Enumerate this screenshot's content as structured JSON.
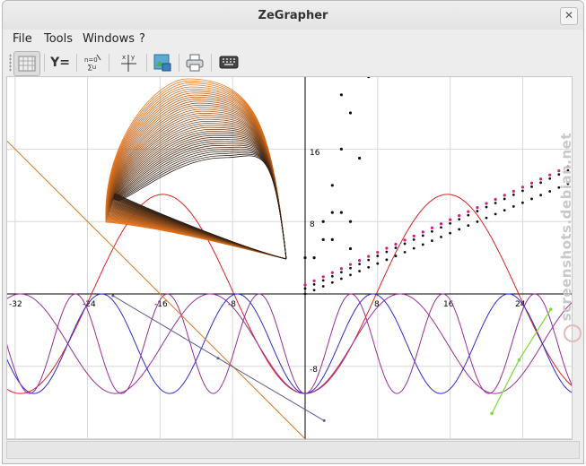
{
  "window": {
    "title": "ZeGrapher"
  },
  "menu": {
    "items": [
      "File",
      "Tools",
      "Windows",
      "?"
    ]
  },
  "toolbar": {
    "grid_button": "grid-toggle",
    "functions_label": "Y=",
    "sequences_label": "x y",
    "params_label": "x | y"
  },
  "graph": {
    "x_ticks": [
      "-32",
      "-24",
      "-16",
      "-8",
      "8",
      "16",
      "24"
    ],
    "y_ticks": [
      "16",
      "8",
      "-8"
    ],
    "colors": {
      "orange": "#e8761e",
      "red": "#e22020",
      "blue": "#2b2bd8",
      "purple": "#9a2e9a",
      "green": "#7bdc3a",
      "gray_line": "#5a5a8a",
      "dots": "#111111",
      "pink": "#d61e78"
    }
  },
  "watermark": {
    "text": "screenshots.debian.net"
  }
}
